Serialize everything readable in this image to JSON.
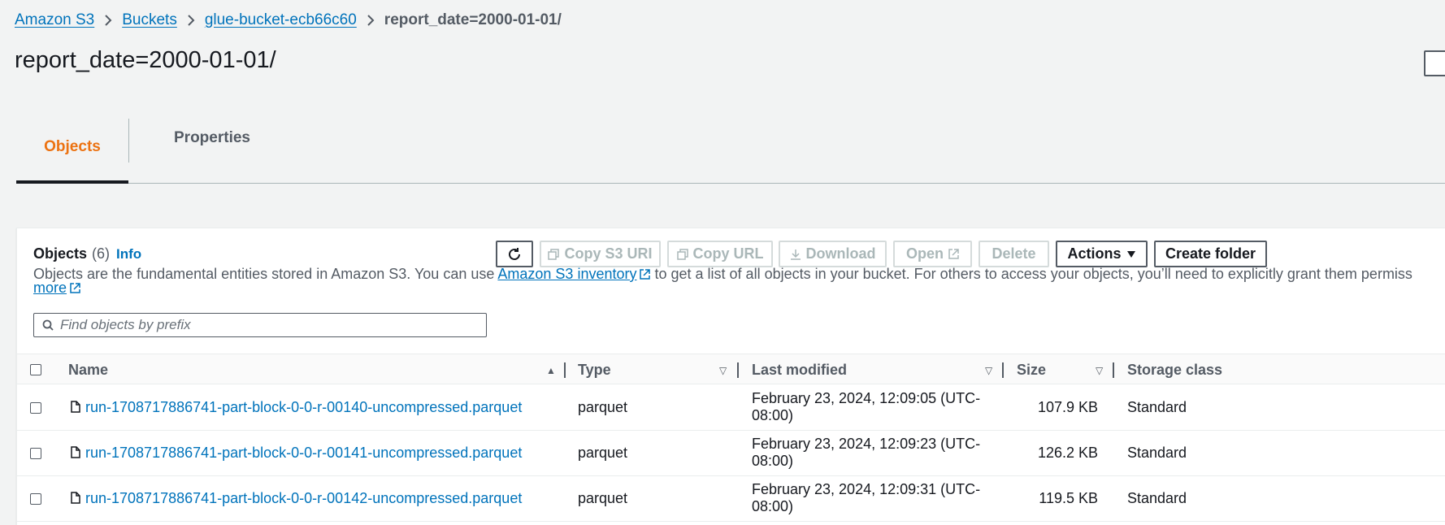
{
  "breadcrumb": {
    "items": [
      "Amazon S3",
      "Buckets",
      "glue-bucket-ecb66c60"
    ],
    "current": "report_date=2000-01-01/"
  },
  "page_title": "report_date=2000-01-01/",
  "tabs": [
    {
      "label": "Objects",
      "active": true
    },
    {
      "label": "Properties",
      "active": false
    }
  ],
  "objects_panel": {
    "title": "Objects",
    "count": "(6)",
    "info": "Info",
    "description_part1": "Objects are the fundamental entities stored in Amazon S3. You can use",
    "inventory_link": "Amazon S3 inventory",
    "description_part2": "to get a list of all objects in your bucket. For others to access your objects, you’ll need to explicitly grant them permiss",
    "learn_more": "more"
  },
  "toolbar": {
    "copy_s3_uri": "Copy S3 URI",
    "copy_url": "Copy URL",
    "download": "Download",
    "open": "Open",
    "delete": "Delete",
    "actions": "Actions",
    "create_folder": "Create folder"
  },
  "search": {
    "placeholder": "Find objects by prefix",
    "value": ""
  },
  "table": {
    "columns": [
      "Name",
      "Type",
      "Last modified",
      "Size",
      "Storage class"
    ],
    "rows": [
      {
        "name": "run-1708717886741-part-block-0-0-r-00140-uncompressed.parquet",
        "type": "parquet",
        "modified_line1": "February 23, 2024, 12:09:05 (UTC-",
        "modified_line2": "08:00)",
        "size": "107.9 KB",
        "storage": "Standard"
      },
      {
        "name": "run-1708717886741-part-block-0-0-r-00141-uncompressed.parquet",
        "type": "parquet",
        "modified_line1": "February 23, 2024, 12:09:23 (UTC-",
        "modified_line2": "08:00)",
        "size": "126.2 KB",
        "storage": "Standard"
      },
      {
        "name": "run-1708717886741-part-block-0-0-r-00142-uncompressed.parquet",
        "type": "parquet",
        "modified_line1": "February 23, 2024, 12:09:31 (UTC-",
        "modified_line2": "08:00)",
        "size": "119.5 KB",
        "storage": "Standard"
      }
    ]
  },
  "colors": {
    "accent": "#ec7211",
    "link": "#0073bb",
    "text": "#16191f",
    "muted": "#545b64"
  }
}
